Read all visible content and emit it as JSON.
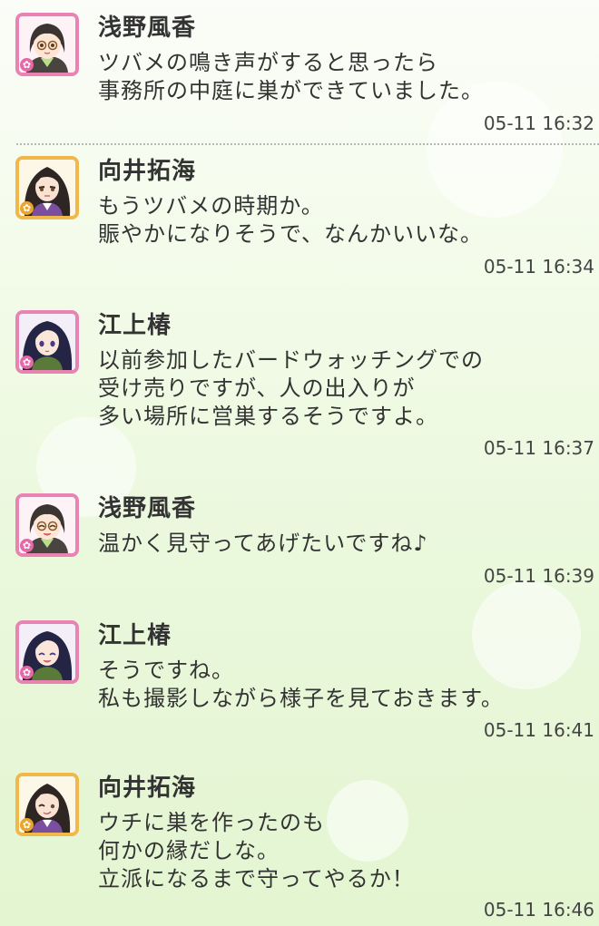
{
  "messages": [
    {
      "sender": "浅野風香",
      "avatar": "fuka-avatar",
      "lines": [
        "ツバメの鳴き声がすると思ったら",
        "事務所の中庭に巣ができていました。"
      ],
      "time": "05-11 16:32"
    },
    {
      "sender": "向井拓海",
      "avatar": "takumi-avatar",
      "lines": [
        "もうツバメの時期か。",
        "賑やかになりそうで、なんかいいな。"
      ],
      "time": "05-11 16:34"
    },
    {
      "sender": "江上椿",
      "avatar": "tsubaki-avatar",
      "lines": [
        "以前参加したバードウォッチングでの",
        "受け売りですが、人の出入りが",
        "多い場所に営巣するそうですよ。"
      ],
      "time": "05-11 16:37"
    },
    {
      "sender": "浅野風香",
      "avatar": "fuka-avatar-smiling",
      "lines": [
        "温かく見守ってあげたいですね♪"
      ],
      "time": "05-11 16:39"
    },
    {
      "sender": "江上椿",
      "avatar": "tsubaki-avatar-smiling",
      "lines": [
        "そうですね。",
        "私も撮影しながら様子を見ておきます。"
      ],
      "time": "05-11 16:41"
    },
    {
      "sender": "向井拓海",
      "avatar": "takumi-avatar-winking",
      "lines": [
        "ウチに巣を作ったのも",
        "何かの縁だしな。",
        "立派になるまで守ってやるか！"
      ],
      "time": "05-11 16:46"
    }
  ],
  "colors": {
    "pink_frame": "#e983b3",
    "gold_frame": "#f0b848",
    "background_top": "#fbfdf8",
    "background_bottom": "#e3f5d1"
  },
  "icons": {
    "frame_badge": "flower-icon"
  }
}
